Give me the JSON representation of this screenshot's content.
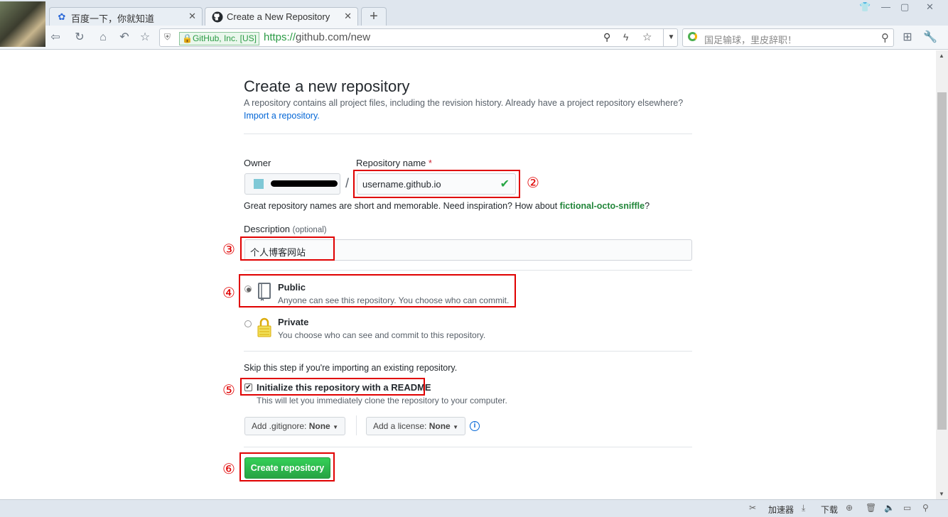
{
  "browser": {
    "tabs": [
      {
        "label": "百度一下，你就知道",
        "icon": "baidu-paw-icon"
      },
      {
        "label": "Create a New Repository",
        "icon": "github-octocat-icon"
      }
    ],
    "ev_badge": "GitHub, Inc. [US]",
    "url_scheme": "https://",
    "url_host": "github.com",
    "url_path": "/new",
    "search_placeholder": "国足输球，里皮辞职！",
    "status_items": [
      "加速器",
      "下载"
    ]
  },
  "page": {
    "title": "Create a new repository",
    "subtitle": "A repository contains all project files, including the revision history. Already have a project repository elsewhere?",
    "import_link": "Import a repository.",
    "owner_label": "Owner",
    "repo_label": "Repository name",
    "required_mark": "*",
    "slash": "/",
    "repo_value": "username.github.io",
    "name_hint_prefix": "Great repository names are short and memorable. Need inspiration? How about ",
    "name_suggestion": "fictional-octo-sniffle",
    "name_hint_suffix": "?",
    "description_label": "Description",
    "description_optional": "(optional)",
    "description_value": "个人博客网站",
    "public_title": "Public",
    "public_desc": "Anyone can see this repository. You choose who can commit.",
    "private_title": "Private",
    "private_desc": "You choose who can see and commit to this repository.",
    "skip_note": "Skip this step if you're importing an existing repository.",
    "readme_label": "Initialize this repository with a README",
    "readme_desc": "This will let you immediately clone the repository to your computer.",
    "gitignore_prefix": "Add .gitignore: ",
    "gitignore_value": "None",
    "license_prefix": "Add a license: ",
    "license_value": "None",
    "create_label": "Create repository"
  },
  "annotations": [
    "②",
    "③",
    "④",
    "⑤",
    "⑥"
  ],
  "colors": {
    "accent_red": "#e00000",
    "create_green": "#2ea44f",
    "link_blue": "#0366d6"
  },
  "visibility_selected": "public",
  "readme_checked": true
}
